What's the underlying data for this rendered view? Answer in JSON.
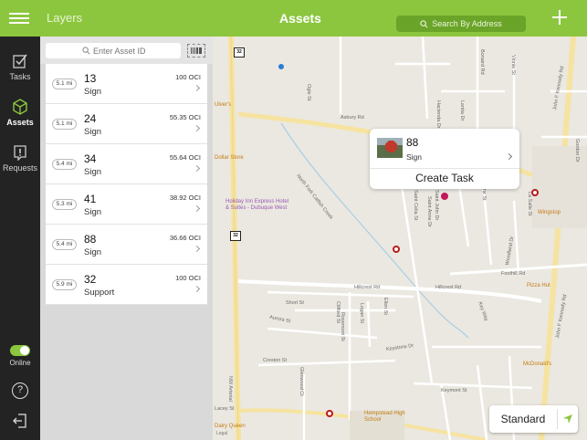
{
  "topbar": {
    "layers_label": "Layers",
    "title": "Assets",
    "search_placeholder": "Search By Address"
  },
  "sidebar": {
    "items": [
      {
        "label": "Tasks",
        "icon": "task-checklist-icon"
      },
      {
        "label": "Assets",
        "icon": "cube-icon",
        "active": true
      },
      {
        "label": "Requests",
        "icon": "alert-notice-icon"
      }
    ],
    "online_label": "Online",
    "online": true
  },
  "asset_search": {
    "placeholder": "Enter Asset ID"
  },
  "assets": [
    {
      "distance": "5.1 mi",
      "id": "13",
      "type": "Sign",
      "oci": "100 OCI"
    },
    {
      "distance": "5.1 mi",
      "id": "24",
      "type": "Sign",
      "oci": "55.35 OCI"
    },
    {
      "distance": "5.4 mi",
      "id": "34",
      "type": "Sign",
      "oci": "55.64 OCI"
    },
    {
      "distance": "5.3 mi",
      "id": "41",
      "type": "Sign",
      "oci": "38.92 OCI"
    },
    {
      "distance": "5.4 mi",
      "id": "88",
      "type": "Sign",
      "oci": "36.66 OCI"
    },
    {
      "distance": "5.9 mi",
      "id": "32",
      "type": "Support",
      "oci": "100 OCI"
    }
  ],
  "map": {
    "callout": {
      "id": "88",
      "type": "Sign",
      "action": "Create Task"
    },
    "map_type": "Standard",
    "route_shield": "32",
    "legal": "Legal",
    "streets": {
      "asbury": "Asbury Rd",
      "hillcrest": "Hillcrest Rd",
      "short": "Short St",
      "aurora": "Aurora St",
      "crestoon": "Creston St",
      "keystone": "Keystone Dr",
      "keymont": "Keymont St",
      "footbill": "Foothill Rd",
      "kennedy1": "John F Kennedy Rd",
      "kennedy2": "John F Kennedy Rd",
      "creek": "North Fork Catfish Creek",
      "woodland": "Woodland Dr",
      "keyway": "Key Way",
      "arterial": "NW Arterial",
      "lacey": "Lacey St",
      "rosemont": "Rosemont St",
      "ellen": "Ellen St",
      "clifford": "Clifford St",
      "logan": "Logan St",
      "glenwood": "Glenwood Ct",
      "saintcelia": "Saint Celia St",
      "saintjohn": "Saint John Dr",
      "saintanne": "Saint Anne Dr",
      "kane": "Kane St",
      "lasalle": "La Salle St",
      "vinnie": "Vinnie St",
      "gordon": "Gordon Dr",
      "ogle": "Ogle St",
      "bonaird": "Bonaird Rd",
      "lenita": "Lenita Dr",
      "hacienda": "Hacienda Dr"
    },
    "pois": {
      "vizer": "Ulver's",
      "dollar": "Dollar Store",
      "holiday": "Holiday Inn Express Hotel & Suites - Dubuque West",
      "wingstop": "Wingstop",
      "pizza": "Pizza Hut",
      "mcd": "McDonald's",
      "school": "Hempstead High School",
      "dairy": "Dairy Queen"
    }
  }
}
